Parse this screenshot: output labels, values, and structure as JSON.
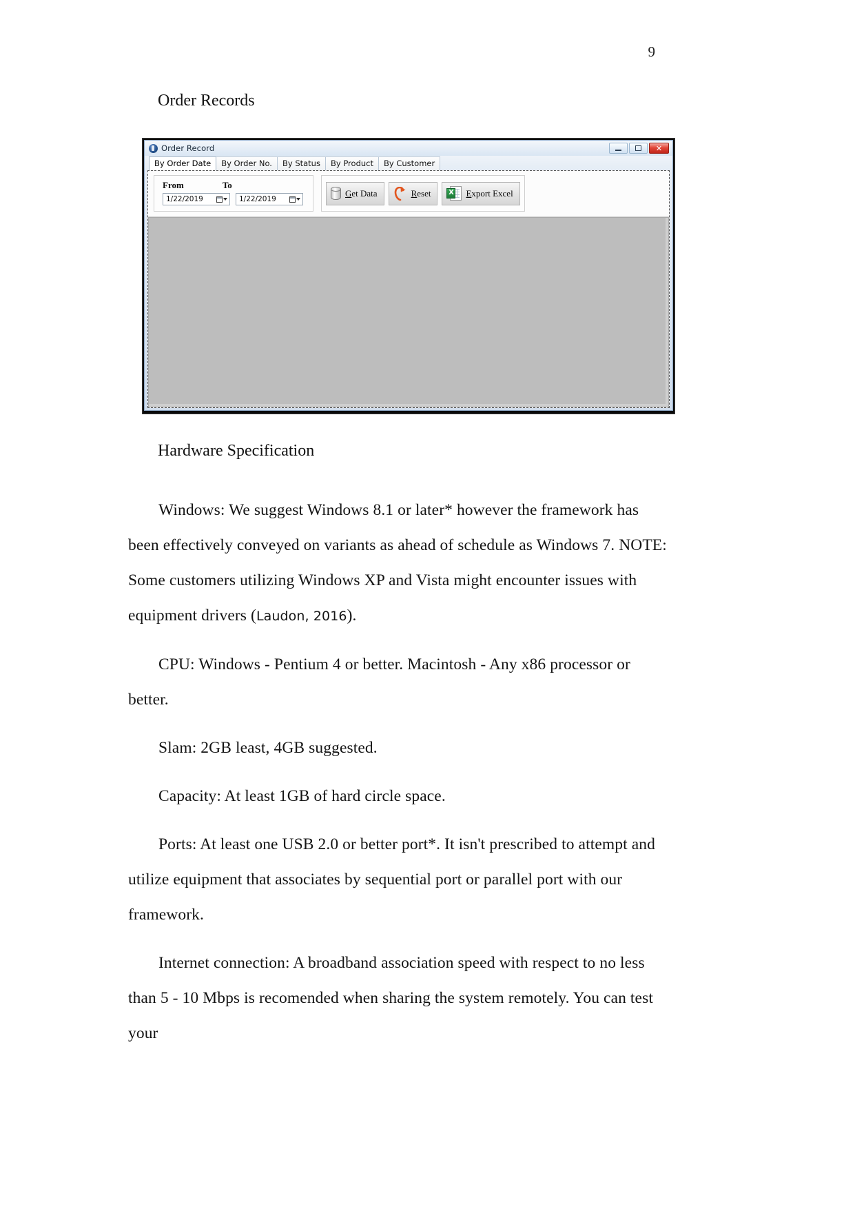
{
  "document": {
    "page_number": "9",
    "caption_order_records": "Order Records",
    "caption_hardware": "Hardware Specification",
    "paragraphs": {
      "windows_p1": "Windows: We suggest Windows 8.1 or later* however the framework has been effectively conveyed on variants as ahead of schedule as Windows 7. NOTE: Some customers utilizing Windows XP and Vista might encounter issues with equipment drivers (",
      "windows_citation": "Laudon, 2016",
      "windows_p1_end": ").",
      "cpu": "CPU: Windows - Pentium 4 or better. Macintosh - Any x86 processor or better.",
      "slam": "Slam: 2GB least, 4GB suggested.",
      "capacity": "Capacity: At least 1GB of hard circle space.",
      "ports": "Ports: At least one USB 2.0 or better port*. It isn't prescribed to attempt and utilize equipment that associates by sequential port or parallel port with our framework.",
      "internet": "Internet connection: A broadband association speed with respect to no less than 5 - 10 Mbps is recomended when sharing the system remotely. You can test your"
    }
  },
  "app_window": {
    "title": "Order Record",
    "title_icon": "app-circle-icon",
    "window_buttons": {
      "minimize": "minimize-icon",
      "maximize": "maximize-icon",
      "close": "✕"
    },
    "tabs": [
      {
        "label": "By Order Date",
        "active": true
      },
      {
        "label": "By Order No.",
        "active": false
      },
      {
        "label": "By Status",
        "active": false
      },
      {
        "label": "By Product",
        "active": false
      },
      {
        "label": "By Customer",
        "active": false
      }
    ],
    "filters": {
      "from_label": "From",
      "to_label": "To",
      "from_value": "1/22/2019",
      "to_value": "1/22/2019",
      "calendar_icon": "calendar-icon",
      "dropdown_icon": "chevron-down-icon"
    },
    "actions": [
      {
        "label_prefix": "G",
        "label_rest": "et Data",
        "icon": "database-icon",
        "name": "get-data-button"
      },
      {
        "label_prefix": "R",
        "label_rest": "eset",
        "icon": "refresh-arrow-icon",
        "name": "reset-button"
      },
      {
        "label_prefix": "E",
        "label_rest": "xport Excel",
        "icon": "excel-icon",
        "name": "export-excel-button"
      }
    ],
    "excel_icon_letter": "X",
    "grid": {
      "empty": true
    }
  },
  "colors": {
    "title_gradient_top": "#f3f7fb",
    "title_gradient_bottom": "#d9e6f3",
    "close_button": "#e2483a",
    "excel_green": "#1d7a38",
    "reset_orange": "#e2561f",
    "grid_background": "#bdbdbd"
  }
}
